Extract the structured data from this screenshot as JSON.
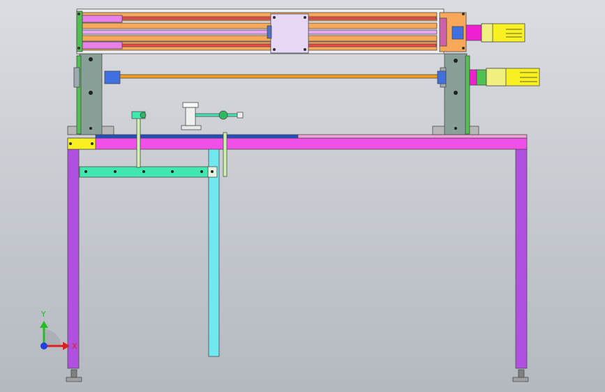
{
  "colors": {
    "bg_top": "#dadde1",
    "bg_bottom": "#b4b9c0",
    "outline": "#4a4a4a",
    "frame_leg": "#b050e0",
    "beam": "#f050e8",
    "support_leg": "#70e8f0",
    "crossbar": "#40e8b0",
    "carriage": "#e8d8f8",
    "rail_red": "#f04848",
    "rail_orange": "#f8a858",
    "rod_lilac": "#e8a8f0",
    "rod_orange": "#f0a020",
    "block_gray": "#88a098",
    "motor_yellow": "#f8f020",
    "coupling_magenta": "#f020d0",
    "green_frame": "#50c050",
    "blue_strip": "#2050c0",
    "axis_x": "#e02020",
    "axis_y": "#20c020",
    "axis_z": "#2040e0"
  },
  "axis_triad": {
    "x_label": "X",
    "y_label": "Y"
  }
}
